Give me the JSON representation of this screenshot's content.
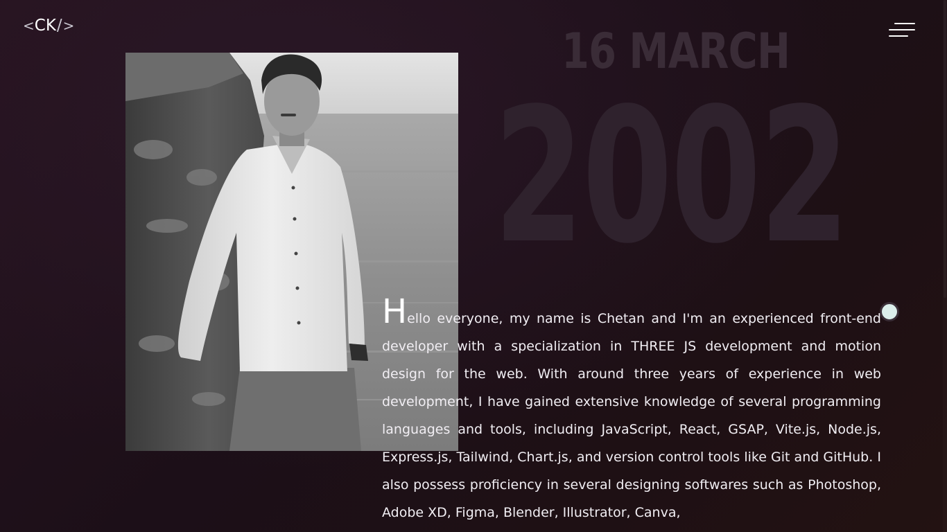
{
  "logo": {
    "open_bracket": "<",
    "text": "CK",
    "slash": "/",
    "close_bracket": ">"
  },
  "header": {
    "menu_icon": "hamburger-menu-icon"
  },
  "background": {
    "date_text": "16 MARCH",
    "year_text": "2002"
  },
  "photo": {
    "alt": "Portrait photo"
  },
  "about": {
    "drop_cap": "H",
    "text": "ello everyone, my name is Chetan and I'm an experienced front-end developer with a specialization in THREE JS development and motion design for the web. With around three years of experience in web development, I have gained extensive knowledge of several programming languages and tools, including JavaScript, React, GSAP, Vite.js, Node.js, Express.js, Tailwind, Chart.js, and version control tools like Git and GitHub. I also possess proficiency in several designing softwares such as Photoshop, Adobe XD, Figma, Blender, Illustrator, Canva,"
  },
  "colors": {
    "background": "#1c0f18",
    "accent_dot": "#dcefeb",
    "watermark": "#2f222d"
  }
}
